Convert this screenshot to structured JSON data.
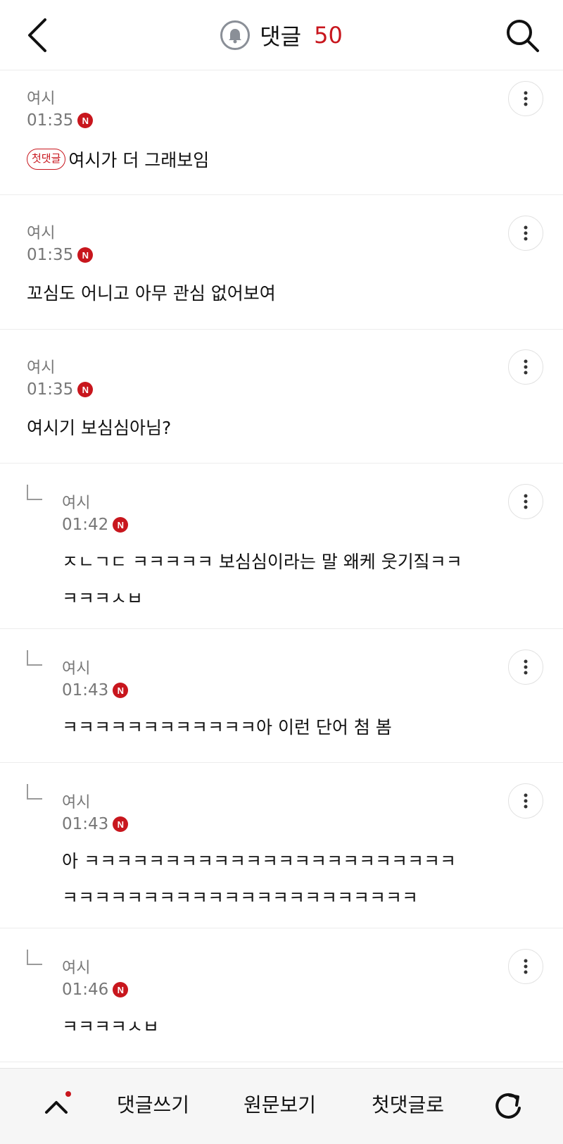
{
  "header": {
    "title": "댓글",
    "count": "50"
  },
  "comments": [
    {
      "author": "여시",
      "time": "01:35",
      "new_badge": "N",
      "first_badge": "첫댓글",
      "text": "여시가 더 그래보임",
      "reply": false
    },
    {
      "author": "여시",
      "time": "01:35",
      "new_badge": "N",
      "text": "꼬심도 어니고 아무 관심 없어보여",
      "reply": false
    },
    {
      "author": "여시",
      "time": "01:35",
      "new_badge": "N",
      "text": "여시기 보심심아님?",
      "reply": false
    },
    {
      "author": "여시",
      "time": "01:42",
      "new_badge": "N",
      "lines": [
        "ㅈㄴㄱㄷ ㅋㅋㅋㅋㅋ 보심심이라는 말 왜케 웃기짘ㅋㅋ",
        "ㅋㅋㅋㅅㅂ"
      ],
      "reply": true
    },
    {
      "author": "여시",
      "time": "01:43",
      "new_badge": "N",
      "text": "ㅋㅋㅋㅋㅋㅋㅋㅋㅋㅋㅋㅋ아 이런 단어 첨 봄",
      "reply": true
    },
    {
      "author": "여시",
      "time": "01:43",
      "new_badge": "N",
      "lines": [
        "아 ㅋㅋㅋㅋㅋㅋㅋㅋㅋㅋㅋㅋㅋㅋㅋㅋㅋㅋㅋㅋㅋㅋㅋ",
        "ㅋㅋㅋㅋㅋㅋㅋㅋㅋㅋㅋㅋㅋㅋㅋㅋㅋㅋㅋㅋㅋㅋ"
      ],
      "reply": true
    },
    {
      "author": "여시",
      "time": "01:46",
      "new_badge": "N",
      "text": "ㅋㅋㅋㅋㅅㅂ",
      "reply": true
    }
  ],
  "bottom_bar": {
    "write_label": "댓글쓰기",
    "original_label": "원문보기",
    "first_comment_label": "첫댓글로"
  },
  "icons": {
    "back": "chevron-left-icon",
    "search": "search-icon",
    "bell": "bell-icon",
    "more": "more-vertical-icon",
    "top": "chevron-up-icon",
    "refresh": "refresh-icon",
    "reply": "reply-arrow-icon"
  },
  "colors": {
    "accent": "#c8161d",
    "muted_text": "#777777",
    "divider": "#ececec"
  }
}
